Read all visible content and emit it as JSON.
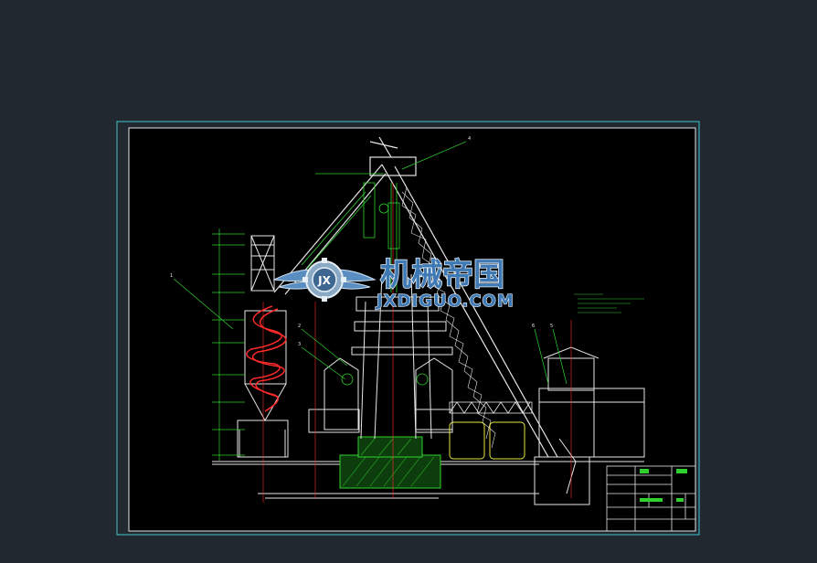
{
  "watermark": {
    "cn_text": "机械帝国",
    "en_text": "JXDIGUO.COM",
    "emblem_text": "JX",
    "icon": "gear-wings-logo-icon"
  },
  "drawing_callouts": [
    "1",
    "2",
    "3",
    "4",
    "5",
    "6"
  ],
  "colors": {
    "background": "#212830",
    "frame_outer": "#3fc6d0",
    "frame_inner": "#ffffff",
    "line_white": "#e6e6e6",
    "line_green": "#2fd12f",
    "line_red": "#ff2a2a",
    "line_yellow": "#e8e840",
    "watermark_blue": "#4a7fb0"
  }
}
